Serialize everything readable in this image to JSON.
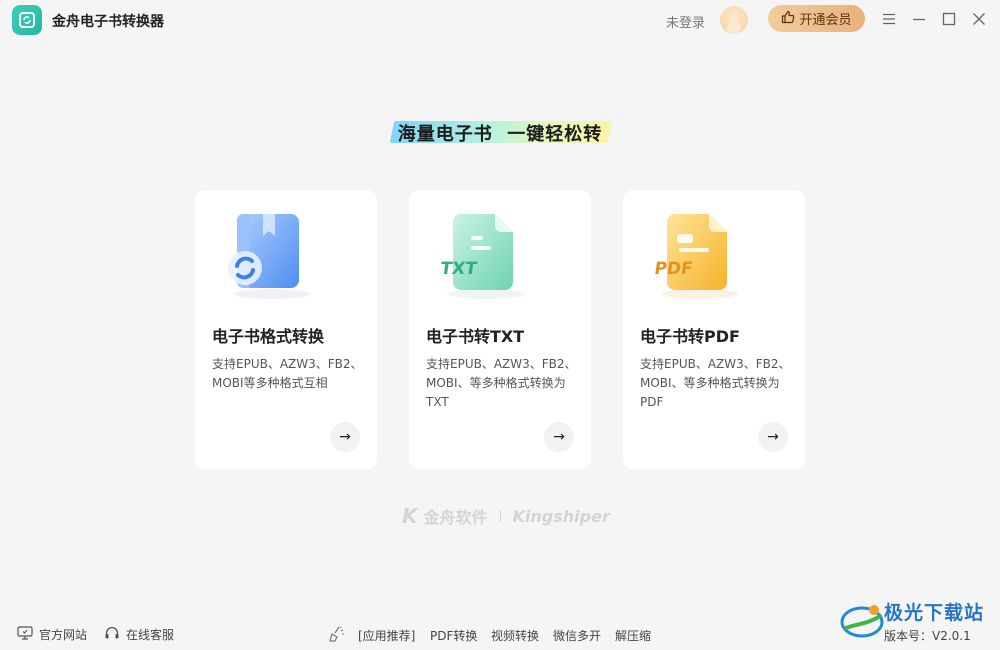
{
  "app": {
    "title": "金舟电子书转换器"
  },
  "header": {
    "login_text": "未登录",
    "vip_label": "开通会员"
  },
  "slogan": "海量电子书  一键轻松转",
  "cards": [
    {
      "title": "电子书格式转换",
      "desc": "支持EPUB、AZW3、FB2、MOBI等多种格式互相"
    },
    {
      "title": "电子书转TXT",
      "desc": "支持EPUB、AZW3、FB2、MOBI、等多种格式转换为TXT",
      "badge": "TXT"
    },
    {
      "title": "电子书转PDF",
      "desc": "支持EPUB、AZW3、FB2、MOBI、等多种格式转换为PDF",
      "badge": "PDF"
    }
  ],
  "brand": {
    "cn": "金舟软件",
    "en": "Kingshiper"
  },
  "footer": {
    "website": "官方网站",
    "support": "在线客服",
    "recommend": "[应用推荐]",
    "links": [
      "PDF转换",
      "视频转换",
      "微信多开",
      "解压缩"
    ],
    "version": "版本号：V2.0.1"
  },
  "watermark": {
    "text": "极光下载站"
  },
  "colors": {
    "vip_gold": "#e8b27a",
    "accent_teal": "#22b7a5",
    "blue": "#5b9cf4",
    "green": "#86dcc3",
    "yellow": "#f6c343"
  },
  "icons": [
    "app-logo-icon",
    "thumb-up-icon",
    "menu-icon",
    "minimize-icon",
    "maximize-icon",
    "close-icon",
    "arrow-right-icon",
    "monitor-icon",
    "headset-icon",
    "broom-icon"
  ]
}
